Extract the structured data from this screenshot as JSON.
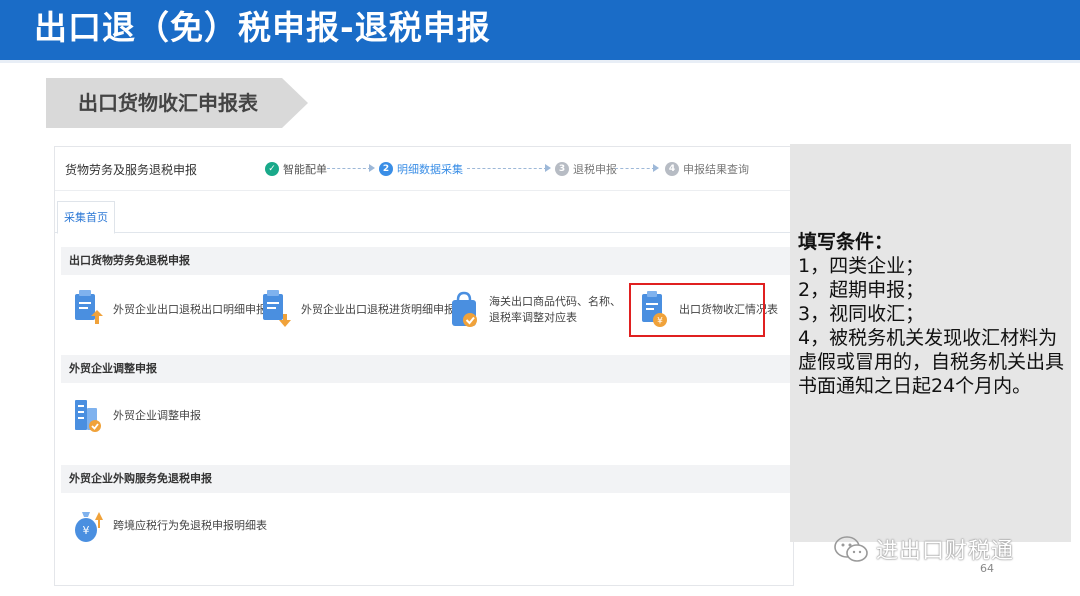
{
  "header": {
    "title": "出口退（免）税申报-退税申报"
  },
  "section": {
    "title": "出口货物收汇申报表"
  },
  "screen": {
    "app_title": "货物劳务及服务退税申报",
    "steps": [
      {
        "num": "✓",
        "label": "智能配单",
        "state": "done"
      },
      {
        "num": "2",
        "label": "明细数据采集",
        "state": "active"
      },
      {
        "num": "3",
        "label": "退税申报",
        "state": "pending"
      },
      {
        "num": "4",
        "label": "申报结果查询",
        "state": "pending"
      }
    ],
    "tab": "采集首页",
    "groups": [
      {
        "title": "出口货物劳务免退税申报",
        "items": [
          {
            "label": "外贸企业出口退税出口明细申报表",
            "icon": "document-upload-icon"
          },
          {
            "label": "外贸企业出口退税进货明细申报表",
            "icon": "document-download-icon"
          },
          {
            "label": "海关出口商品代码、名称、退税率调整对应表",
            "icon": "shopping-bag-check-icon"
          },
          {
            "label": "出口货物收汇情况表",
            "icon": "receipt-yuan-icon"
          }
        ]
      },
      {
        "title": "外贸企业调整申报",
        "items": [
          {
            "label": "外贸企业调整申报",
            "icon": "building-adjust-icon"
          }
        ]
      },
      {
        "title": "外贸企业外购服务免退税申报",
        "items": [
          {
            "label": "跨境应税行为免退税申报明细表",
            "icon": "money-bag-icon"
          }
        ]
      }
    ]
  },
  "side_panel": {
    "heading": "填写条件：",
    "lines": [
      "1，四类企业；",
      "2，超期申报；",
      "3，视同收汇；",
      "4，被税务机关发现收汇材料为虚假或冒用的，自税务机关出具书面通知之日起24个月内。"
    ]
  },
  "watermark": {
    "text": "进出口财税通",
    "icon": "wechat-icon"
  },
  "page_number": "64",
  "colors": {
    "header_blue": "#1a6cc7",
    "step_done": "#19a98a",
    "step_active": "#3a8ee6",
    "step_pending": "#b7bcc4",
    "highlight": "#e02020",
    "icon_blue": "#4a8fe0",
    "icon_orange": "#f0a23a"
  }
}
